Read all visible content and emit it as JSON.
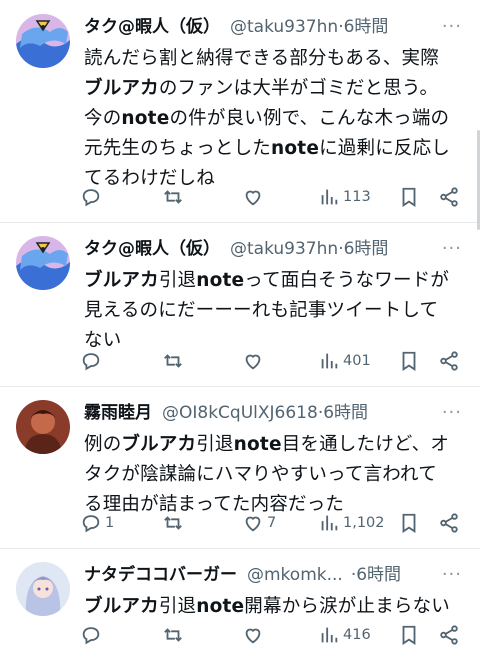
{
  "tweets": [
    {
      "name": "タク@暇人（仮）",
      "handle": "@taku937hn",
      "time": "6時間",
      "lines": [
        [
          {
            "t": "読んだら割と納得できる部分もある、実際"
          }
        ],
        [
          {
            "t": "ブルアカ",
            "b": true
          },
          {
            "t": "のファンは大半がゴミだと思う。"
          }
        ],
        [
          {
            "t": "今の"
          },
          {
            "t": "note",
            "b": true
          },
          {
            "t": "の件が良い例で、こんな木っ端の"
          }
        ],
        [
          {
            "t": "元先生のちょっとした"
          },
          {
            "t": "note",
            "b": true
          },
          {
            "t": "に過剰に反応し"
          }
        ],
        [
          {
            "t": "てるわけだしね"
          }
        ]
      ],
      "reply_count": "",
      "retweet_count": "",
      "like_count": "",
      "view_count": "113"
    },
    {
      "name": "タク@暇人（仮）",
      "handle": "@taku937hn",
      "time": "6時間",
      "lines": [
        [
          {
            "t": "ブルアカ",
            "b": true
          },
          {
            "t": "引退"
          },
          {
            "t": "note",
            "b": true
          },
          {
            "t": "って面白そうなワードが"
          }
        ],
        [
          {
            "t": "見えるのにだーーーれも記事ツイートして"
          }
        ],
        [
          {
            "t": "ない"
          }
        ]
      ],
      "reply_count": "",
      "retweet_count": "",
      "like_count": "",
      "view_count": "401"
    },
    {
      "name": "霧雨睦月",
      "handle": "@OI8kCqUlXJ6618",
      "time": "6時間",
      "lines": [
        [
          {
            "t": "例の"
          },
          {
            "t": "ブルアカ",
            "b": true
          },
          {
            "t": "引退"
          },
          {
            "t": "note",
            "b": true
          },
          {
            "t": "目を通したけど、オ"
          }
        ],
        [
          {
            "t": "タクが陰謀論にハマりやすいって言われて"
          }
        ],
        [
          {
            "t": "る理由が詰まってた内容だった"
          }
        ]
      ],
      "reply_count": "1",
      "retweet_count": "",
      "like_count": "7",
      "view_count": "1,102"
    },
    {
      "name": "ナタデココバーガー",
      "handle": "@mkomk...",
      "time": "6時間",
      "lines": [
        [
          {
            "t": "ブルアカ",
            "b": true
          },
          {
            "t": "引退"
          },
          {
            "t": "note",
            "b": true
          },
          {
            "t": "開幕から涙が止まらない"
          }
        ]
      ],
      "reply_count": "",
      "retweet_count": "",
      "like_count": "",
      "view_count": "416"
    }
  ],
  "separator": "·",
  "colors": {
    "text": "#0f1419",
    "muted": "#536471",
    "border": "#e6e9ec"
  }
}
